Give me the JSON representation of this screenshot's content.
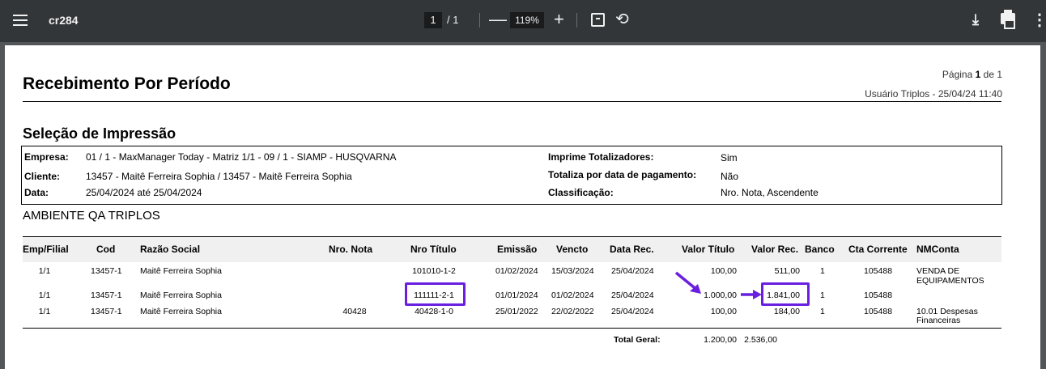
{
  "toolbar": {
    "title": "cr284",
    "page_current": "1",
    "page_of": "/ 1",
    "zoom": "119%",
    "minus_glyph": "—",
    "plus_glyph": "+",
    "rotate_glyph": "⟲",
    "download_glyph": "⤓",
    "more_glyph": "⋮"
  },
  "report": {
    "title": "Recebimento Por Período",
    "page_label": "Página",
    "page_num": "1",
    "page_of": "de 1",
    "user_stamp": "Usuário Triplos - 25/04/24 11:40",
    "selection_title": "Seleção de Impressão",
    "selection": {
      "empresa_label": "Empresa:",
      "empresa_value": "01 / 1 - MaxManager Today - Matriz 1/1 - 09 / 1 - SIAMP - HUSQVARNA",
      "cliente_label": "Cliente:",
      "cliente_value": "13457 - Maitê Ferreira Sophia / 13457 - Maitê Ferreira Sophia",
      "data_label": "Data:",
      "data_value": "25/04/2024 até 25/04/2024",
      "totalizadores_label": "Imprime Totalizadores:",
      "totalizadores_value": "Sim",
      "totaliza_label": "Totaliza por data de pagamento:",
      "totaliza_value": "Não",
      "classificacao_label": "Classificação:",
      "classificacao_value": "Nro. Nota, Ascendente"
    },
    "environment": "AMBIENTE QA TRIPLOS",
    "columns": [
      "Emp/Filial",
      "Cod",
      "Razão Social",
      "Nro. Nota",
      "Nro Título",
      "Emissão",
      "Vencto",
      "Data Rec.",
      "Valor Título",
      "Valor Rec.",
      "Banco",
      "Cta Corrente",
      "NMConta"
    ],
    "rows": [
      {
        "emp": "1/1",
        "cod": "13457-1",
        "razao": "Maitê Ferreira Sophia",
        "nota": "",
        "titulo": "101010-1-2",
        "emissao": "01/02/2024",
        "vencto": "15/03/2024",
        "datarec": "25/04/2024",
        "valor_titulo": "100,00",
        "valor_rec": "511,00",
        "banco": "1",
        "cta": "105488",
        "nmconta_1": "VENDA DE",
        "nmconta_2": "EQUIPAMENTOS"
      },
      {
        "emp": "1/1",
        "cod": "13457-1",
        "razao": "Maitê Ferreira Sophia",
        "nota": "",
        "titulo": "111111-2-1",
        "emissao": "01/01/2024",
        "vencto": "01/02/2024",
        "datarec": "25/04/2024",
        "valor_titulo": "1.000,00",
        "valor_rec": "1.841,00",
        "banco": "1",
        "cta": "105488",
        "nmconta_1": "",
        "nmconta_2": ""
      },
      {
        "emp": "1/1",
        "cod": "13457-1",
        "razao": "Maitê Ferreira Sophia",
        "nota": "40428",
        "titulo": "40428-1-0",
        "emissao": "25/01/2022",
        "vencto": "22/02/2022",
        "datarec": "25/04/2024",
        "valor_titulo": "100,00",
        "valor_rec": "184,00",
        "banco": "1",
        "cta": "105488",
        "nmconta_1": "10.01 Despesas",
        "nmconta_2": "Financeiras"
      }
    ],
    "total_label": "Total Geral:",
    "total_valor_titulo": "1.200,00",
    "total_valor_rec": "2.536,00"
  },
  "colors": {
    "toolbar_bg": "#323639",
    "viewer_bg": "#525659",
    "highlight": "#6a1fe0"
  }
}
